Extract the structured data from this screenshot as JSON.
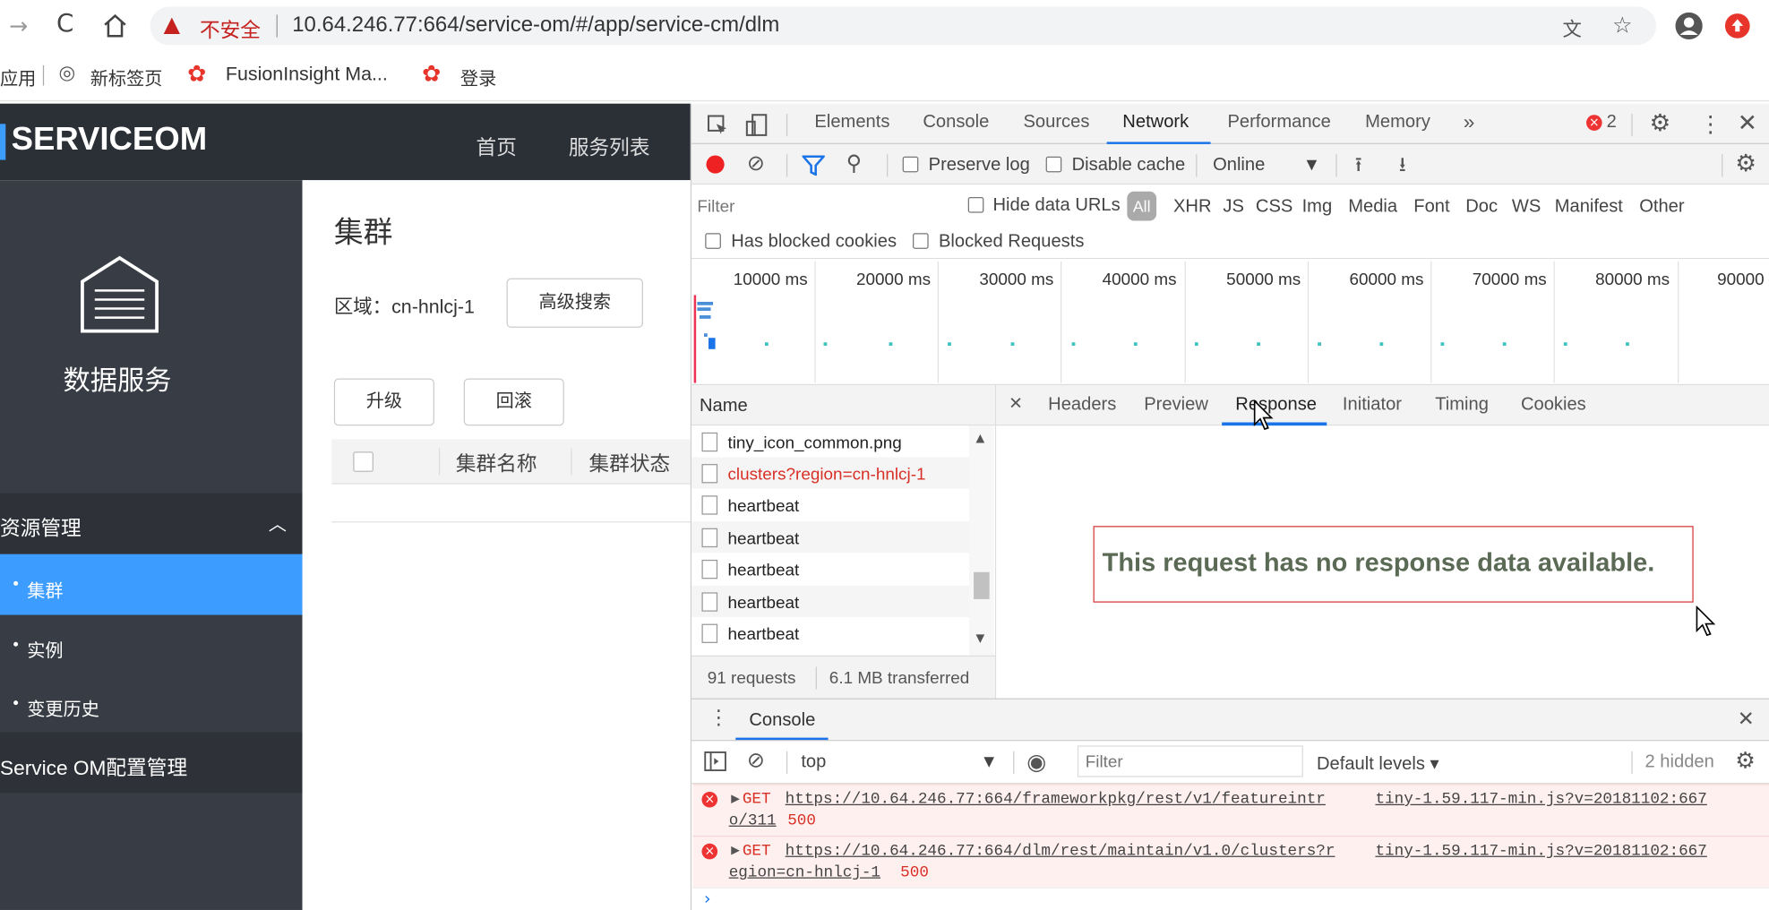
{
  "browser": {
    "security_label": "不安全",
    "url": "10.64.246.77:664/service-om/#/app/service-cm/dlm",
    "bookmarks": [
      "应用",
      "新标签页",
      "FusionInsight Ma...",
      "登录"
    ]
  },
  "app": {
    "logo_text": "SERVICEOM",
    "nav": [
      "首页",
      "服务列表"
    ],
    "sidebar": {
      "service_title": "数据服务",
      "group_label": "资源管理",
      "items": [
        "集群",
        "实例",
        "变更历史"
      ],
      "config_label": "Service OM配置管理"
    },
    "main": {
      "title": "集群",
      "region_label": "区域：cn-hnlcj-1",
      "advanced_search": "高级搜索",
      "upgrade": "升级",
      "rollback": "回滚",
      "columns": [
        "集群名称",
        "集群状态"
      ]
    }
  },
  "devtools": {
    "tabs": [
      "Elements",
      "Console",
      "Sources",
      "Network",
      "Performance",
      "Memory",
      "»"
    ],
    "active_tab": "Network",
    "error_count": "2",
    "toolbar": {
      "preserve_log": "Preserve log",
      "disable_cache": "Disable cache",
      "throttle": "Online"
    },
    "filter": {
      "placeholder": "Filter",
      "hide_data_urls": "Hide data URLs",
      "types": [
        "All",
        "XHR",
        "JS",
        "CSS",
        "Img",
        "Media",
        "Font",
        "Doc",
        "WS",
        "Manifest",
        "Other"
      ],
      "blocked_cookies": "Has blocked cookies",
      "blocked_requests": "Blocked Requests"
    },
    "timeline_ticks": [
      "10000 ms",
      "20000 ms",
      "30000 ms",
      "40000 ms",
      "50000 ms",
      "60000 ms",
      "70000 ms",
      "80000 ms",
      "90000"
    ],
    "requests": {
      "header": "Name",
      "items": [
        "tiny_icon_common.png",
        "clusters?region=cn-hnlcj-1",
        "heartbeat",
        "heartbeat",
        "heartbeat",
        "heartbeat",
        "heartbeat"
      ],
      "status": "91 requests",
      "transferred": "6.1 MB transferred"
    },
    "detail_tabs": [
      "Headers",
      "Preview",
      "Response",
      "Initiator",
      "Timing",
      "Cookies"
    ],
    "active_detail_tab": "Response",
    "no_response_message": "This request has no response data available.",
    "console": {
      "tab": "Console",
      "context": "top",
      "filter_placeholder": "Filter",
      "levels": "Default levels ▾",
      "hidden": "2 hidden",
      "errors": [
        {
          "method": "GET",
          "url_line1": "https://10.64.246.77:664/frameworkpkg/rest/v1/featureintr",
          "url_line2": "o/311",
          "status": "500",
          "source": "tiny-1.59.117-min.js?v=20181102:667"
        },
        {
          "method": "GET",
          "url_line1": "https://10.64.246.77:664/dlm/rest/maintain/v1.0/clusters?r",
          "url_line2": "egion=cn-hnlcj-1",
          "status": "500",
          "source": "tiny-1.59.117-min.js?v=20181102:667"
        }
      ]
    }
  }
}
